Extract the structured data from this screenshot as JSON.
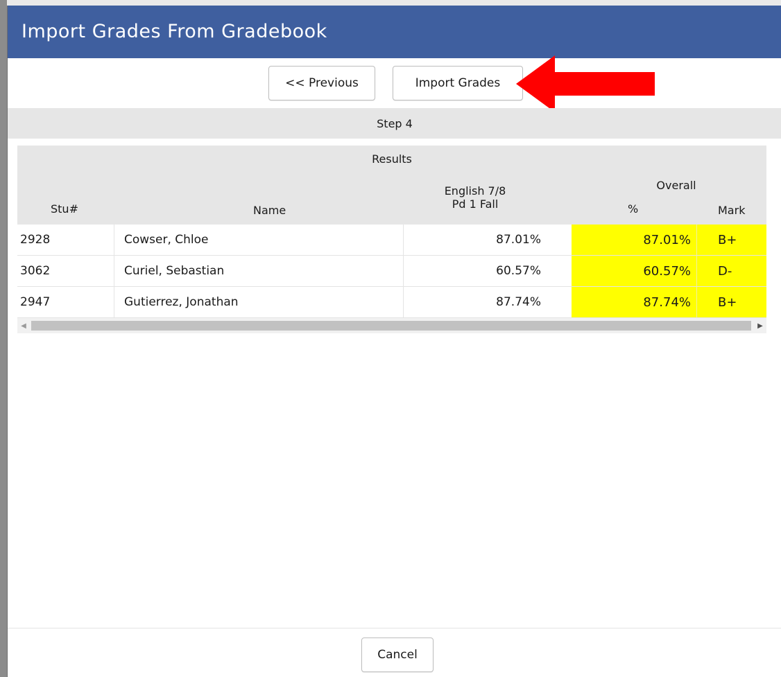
{
  "dialog": {
    "title": "Import Grades From Gradebook"
  },
  "toolbar": {
    "previous_label": "<< Previous",
    "import_label": "Import Grades"
  },
  "step": {
    "label": "Step 4"
  },
  "results": {
    "caption": "Results",
    "headers": {
      "stu": "Stu#",
      "name": "Name",
      "course_line1": "English 7/8",
      "course_line2": "Pd 1 Fall",
      "overall": "Overall",
      "percent": "%",
      "mark": "Mark"
    },
    "rows": [
      {
        "stu": "2928",
        "name": "Cowser, Chloe",
        "course": "87.01%",
        "pct": "87.01%",
        "mark": "B+"
      },
      {
        "stu": "3062",
        "name": "Curiel, Sebastian",
        "course": "60.57%",
        "pct": "60.57%",
        "mark": "D-"
      },
      {
        "stu": "2947",
        "name": "Gutierrez, Jonathan",
        "course": "87.74%",
        "pct": "87.74%",
        "mark": "B+"
      }
    ]
  },
  "footer": {
    "cancel_label": "Cancel"
  },
  "colors": {
    "titlebar": "#3f5f9f",
    "highlight": "#ffff00",
    "arrow": "#ff0000",
    "header_bg": "#e6e6e6"
  },
  "icons": {
    "scroll_left": "triangle-left-icon",
    "scroll_right": "triangle-right-icon",
    "annotation": "red-arrow-icon"
  }
}
